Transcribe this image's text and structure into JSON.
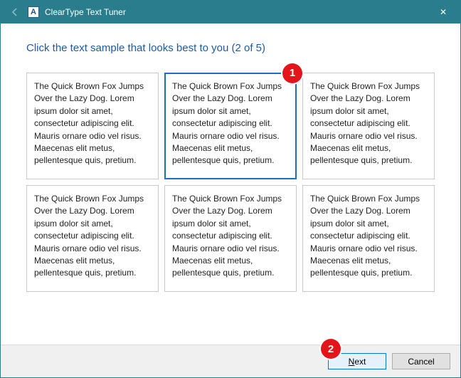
{
  "window": {
    "app_icon_letter": "A",
    "title": "ClearType Text Tuner",
    "close_glyph": "✕",
    "back_glyph": "←"
  },
  "heading": "Click the text sample that looks best to you (2 of 5)",
  "sample_text": "The Quick Brown Fox Jumps Over the Lazy Dog. Lorem ipsum dolor sit amet, consectetur adipiscing elit. Mauris ornare odio vel risus. Maecenas elit metus, pellentesque quis, pretium.",
  "samples": [
    {
      "selected": false
    },
    {
      "selected": true
    },
    {
      "selected": false
    },
    {
      "selected": false
    },
    {
      "selected": false
    },
    {
      "selected": false
    }
  ],
  "footer": {
    "next_hotkey": "N",
    "next_rest": "ext",
    "cancel": "Cancel"
  },
  "annotations": {
    "badge1": "1",
    "badge2": "2"
  }
}
